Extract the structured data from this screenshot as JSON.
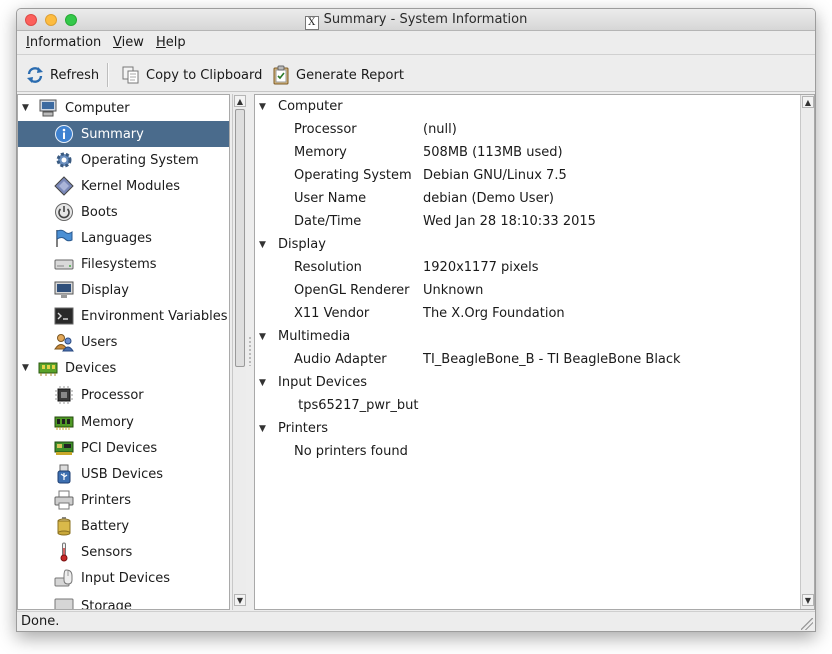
{
  "window": {
    "title": "Summary - System Information",
    "x_logo": "X"
  },
  "menubar": {
    "items": [
      {
        "label": "Information"
      },
      {
        "label": "View"
      },
      {
        "label": "Help"
      }
    ]
  },
  "toolbar": {
    "refresh_label": "Refresh",
    "copy_label": "Copy to Clipboard",
    "report_label": "Generate Report"
  },
  "tree": {
    "items": [
      {
        "label": "Computer",
        "icon": "computer-icon",
        "level": 0,
        "expanded": true
      },
      {
        "label": "Summary",
        "icon": "info-icon",
        "level": 1,
        "selected": true
      },
      {
        "label": "Operating System",
        "icon": "gear-icon",
        "level": 1
      },
      {
        "label": "Kernel Modules",
        "icon": "module-icon",
        "level": 1
      },
      {
        "label": "Boots",
        "icon": "power-icon",
        "level": 1
      },
      {
        "label": "Languages",
        "icon": "flag-icon",
        "level": 1
      },
      {
        "label": "Filesystems",
        "icon": "drive-icon",
        "level": 1
      },
      {
        "label": "Display",
        "icon": "monitor-icon",
        "level": 1
      },
      {
        "label": "Environment Variables",
        "icon": "terminal-icon",
        "level": 1
      },
      {
        "label": "Users",
        "icon": "users-icon",
        "level": 1
      },
      {
        "label": "Devices",
        "icon": "devices-icon",
        "level": 0,
        "expanded": true
      },
      {
        "label": "Processor",
        "icon": "cpu-icon",
        "level": 1
      },
      {
        "label": "Memory",
        "icon": "memory-icon",
        "level": 1
      },
      {
        "label": "PCI Devices",
        "icon": "pci-icon",
        "level": 1
      },
      {
        "label": "USB Devices",
        "icon": "usb-icon",
        "level": 1
      },
      {
        "label": "Printers",
        "icon": "printer-icon",
        "level": 1
      },
      {
        "label": "Battery",
        "icon": "battery-icon",
        "level": 1
      },
      {
        "label": "Sensors",
        "icon": "thermometer-icon",
        "level": 1
      },
      {
        "label": "Input Devices",
        "icon": "input-icon",
        "level": 1
      },
      {
        "label": "Storage",
        "icon": "storage-icon",
        "level": 1
      }
    ]
  },
  "details": {
    "sections": [
      {
        "title": "Computer",
        "rows": [
          {
            "key": "Processor",
            "value": "(null)"
          },
          {
            "key": "Memory",
            "value": "508MB (113MB used)"
          },
          {
            "key": "Operating System",
            "value": "Debian GNU/Linux 7.5"
          },
          {
            "key": "User Name",
            "value": "debian (Demo User)"
          },
          {
            "key": "Date/Time",
            "value": "Wed Jan 28 18:10:33 2015"
          }
        ]
      },
      {
        "title": "Display",
        "rows": [
          {
            "key": "Resolution",
            "value": "1920x1177 pixels"
          },
          {
            "key": "OpenGL Renderer",
            "value": "Unknown"
          },
          {
            "key": "X11 Vendor",
            "value": "The X.Org Foundation"
          }
        ]
      },
      {
        "title": "Multimedia",
        "rows": [
          {
            "key": "Audio Adapter",
            "value": "TI_BeagleBone_B - TI BeagleBone Black"
          }
        ]
      },
      {
        "title": "Input Devices",
        "rows": [
          {
            "key": " tps65217_pwr_but",
            "value": ""
          }
        ]
      },
      {
        "title": "Printers",
        "rows": [
          {
            "key": "No printers found",
            "value": ""
          }
        ]
      }
    ]
  },
  "status": {
    "text": "Done."
  },
  "colors": {
    "selection": "#4a6b8c",
    "window_bg": "#ededed"
  }
}
